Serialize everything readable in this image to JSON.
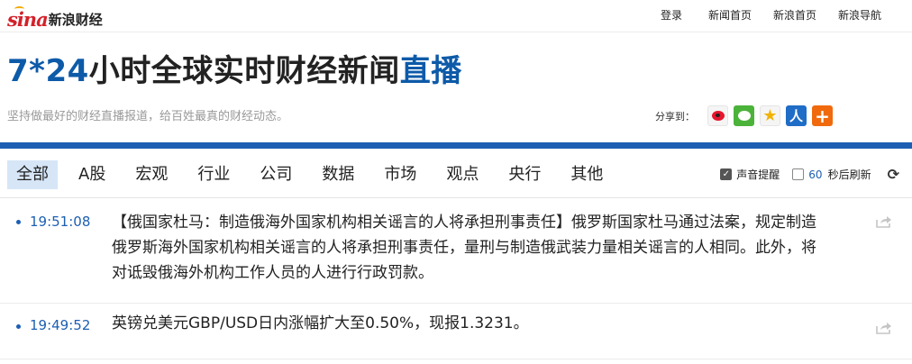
{
  "logo": {
    "brand": "sina",
    "product": "新浪财经"
  },
  "top_nav": {
    "links": [
      "登录",
      "新闻首页",
      "新浪首页",
      "新浪导航"
    ]
  },
  "header": {
    "title_prefix": "7*24",
    "title_main": "小时全球实时财经新闻",
    "title_highlight": "直播",
    "subtitle": "坚持做最好的财经直播报道，给百姓最真的财经动态。",
    "share_label": "分享到：",
    "share_icons": [
      "weibo-icon",
      "wechat-icon",
      "qzone-icon",
      "renren-icon",
      "more-share-icon"
    ]
  },
  "tabs": [
    "全部",
    "A股",
    "宏观",
    "行业",
    "公司",
    "数据",
    "市场",
    "观点",
    "央行",
    "其他"
  ],
  "active_tab": "全部",
  "controls": {
    "sound_label": "声音提醒",
    "sound_checked": true,
    "refresh_seconds": "60",
    "refresh_label": "秒后刷新",
    "refresh_checked": false
  },
  "feed": [
    {
      "time": "19:51:08",
      "text": "【俄国家杜马：制造俄海外国家机构相关谣言的人将承担刑事责任】俄罗斯国家杜马通过法案，规定制造俄罗斯海外国家机构相关谣言的人将承担刑事责任，量刑与制造俄武装力量相关谣言的人相同。此外，将对诋毁俄海外机构工作人员的人进行行政罚款。"
    },
    {
      "time": "19:49:52",
      "text": "英镑兑美元GBP/USD日内涨幅扩大至0.50%，现报1.3231。"
    }
  ],
  "colors": {
    "accent_blue": "#1d5fb3",
    "title_highlight": "#0d5aa8",
    "logo_red": "#d3222a",
    "active_tab_bg": "#d6e6f7"
  }
}
